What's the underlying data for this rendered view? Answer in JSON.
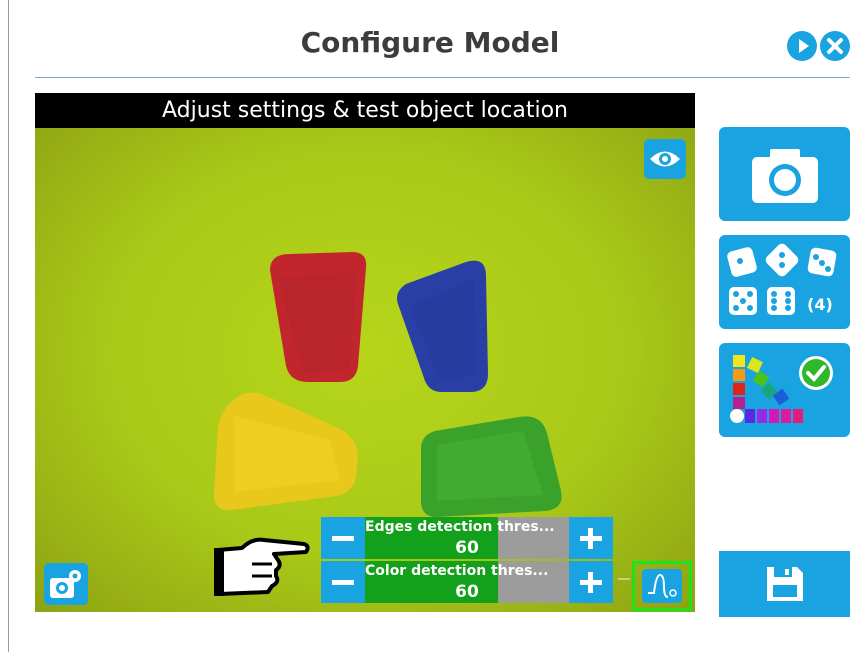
{
  "header": {
    "title": "Configure Model",
    "play_icon": "play-icon",
    "close_icon": "close-icon"
  },
  "viewer": {
    "caption": "Adjust settings & test object location",
    "pieces": [
      "red",
      "blue",
      "yellow",
      "green"
    ],
    "eye_icon": "eye-icon",
    "camera_settings_icon": "camera-settings-icon"
  },
  "sliders": [
    {
      "label": "Edges detection thres...",
      "value": "60",
      "fill_percent": 65
    },
    {
      "label": "Color detection thres...",
      "value": "60",
      "fill_percent": 65
    }
  ],
  "sidebar": {
    "camera_icon": "camera-icon",
    "dice_icon": "dice-icon",
    "dice_count": "(4)",
    "color_palette_icon": "color-palette-icon",
    "save_icon": "save-icon"
  },
  "colors": {
    "accent": "#19a3e0",
    "slider_fill": "#13a01a",
    "highlight": "#1ee21e"
  }
}
